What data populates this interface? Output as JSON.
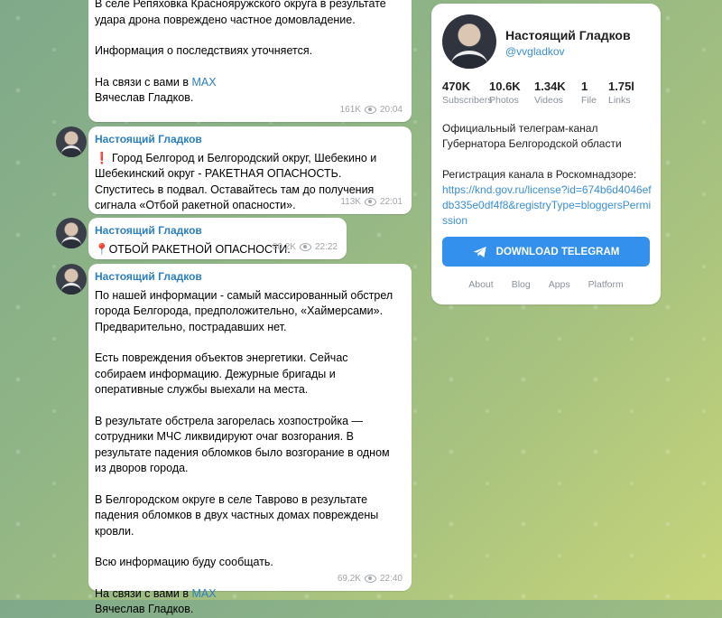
{
  "feed": {
    "messages": [
      {
        "author": "",
        "paragraphs": [
          "В селе Репяховка Краснояружского округа в результате удара дрона повреждено частное домовладение.",
          "Информация о последствиях уточняется."
        ],
        "sign_prefix": "На связи с вами в ",
        "sign_link": "MAX",
        "sign_name": "Вячеслав Гладков.",
        "views": "161K",
        "time": "20:04"
      },
      {
        "author": "Настоящий Гладков",
        "text": "❗ Город Белгород и Белгородский округ, Шебекино и Шебекинский округ - РАКЕТНАЯ ОПАСНОСТЬ. Спуститесь в подвал. Оставайтесь там до получения сигнала «Отбой ракетной опасности».",
        "views": "113K",
        "time": "22:01"
      },
      {
        "author": "Настоящий Гладков",
        "text": "📍ОТБОЙ РАКЕТНОЙ ОПАСНОСТИ.",
        "views": "80.2K",
        "time": "22:22"
      },
      {
        "author": "Настоящий Гладков",
        "paragraphs": [
          "По нашей информации - самый массированный обстрел города Белгорода, предположительно, «Хаймерсами». Предварительно, пострадавших нет.",
          "Есть повреждения объектов энергетики. Сейчас собираем информацию. Дежурные бригады и оперативные службы выехали на места.",
          "В результате обстрела загорелась хозпостройка — сотрудники МЧС ликвидируют очаг возгорания. В результате падения обломков было возгорание в одном из дворов города.",
          "В Белгородском округе в селе Таврово в результате падения обломков в двух частных домах повреждены кровли.",
          "Всю информацию буду сообщать."
        ],
        "sign_prefix": "На связи с вами в ",
        "sign_link": "MAX",
        "sign_name": "Вячеслав Гладков.",
        "views": "69.2K",
        "time": "22:40"
      }
    ]
  },
  "channel": {
    "name": "Настоящий Гладков",
    "handle": "@vvgladkov",
    "stats": [
      {
        "num": "470K",
        "label": "Subscribers"
      },
      {
        "num": "10.6K",
        "label": "Photos"
      },
      {
        "num": "1.34K",
        "label": "Videos"
      },
      {
        "num": "1",
        "label": "File"
      },
      {
        "num": "1.75l",
        "label": "Links"
      }
    ],
    "description": "Официальный телеграм-канал Губернатора Белгородской области",
    "reg_text": "Регистрация канала в Роскомнадзоре:",
    "reg_url": "https://knd.gov.ru/license?id=674b6d4046efdb335e0df4f8&registryType=bloggersPermission",
    "download_label": "DOWNLOAD TELEGRAM",
    "footer_links": [
      "About",
      "Blog",
      "Apps",
      "Platform"
    ]
  }
}
